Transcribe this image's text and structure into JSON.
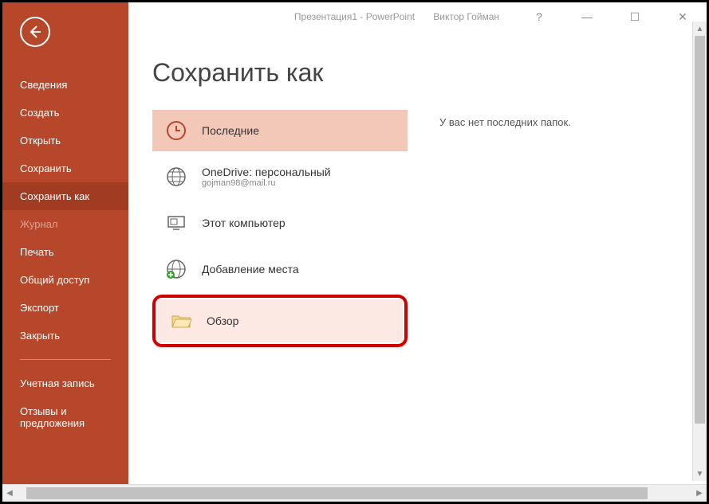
{
  "titlebar": {
    "title": "Презентация1 - PowerPoint",
    "user": "Виктор Гойман",
    "help": "?"
  },
  "sidebar": {
    "back": "←",
    "items": [
      {
        "label": "Сведения"
      },
      {
        "label": "Создать"
      },
      {
        "label": "Открыть"
      },
      {
        "label": "Сохранить"
      },
      {
        "label": "Сохранить как",
        "selected": true
      },
      {
        "label": "Журнал",
        "dim": true
      },
      {
        "label": "Печать"
      },
      {
        "label": "Общий доступ"
      },
      {
        "label": "Экспорт"
      },
      {
        "label": "Закрыть"
      },
      {
        "sep": true
      },
      {
        "label": "Учетная запись"
      },
      {
        "label": "Отзывы и предложения"
      }
    ]
  },
  "main": {
    "heading": "Сохранить как",
    "locations": {
      "recent": {
        "label": "Последние"
      },
      "onedrive": {
        "label": "OneDrive: персональный",
        "sub": "gojman98@mail.ru"
      },
      "thispc": {
        "label": "Этот компьютер"
      },
      "addplace": {
        "label": "Добавление места"
      },
      "browse": {
        "label": "Обзор"
      }
    },
    "right_pane": {
      "empty_text": "У вас нет последних папок."
    }
  }
}
